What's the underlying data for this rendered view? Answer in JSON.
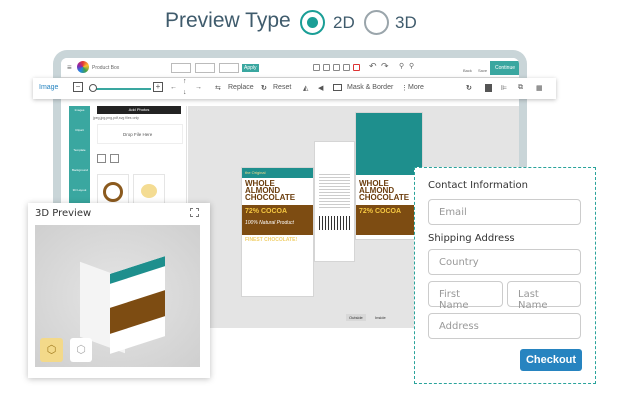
{
  "preview_type": {
    "title": "Preview Type",
    "options": [
      {
        "label": "2D",
        "selected": true
      },
      {
        "label": "3D",
        "selected": false
      }
    ],
    "accent": "#1a9e96"
  },
  "editor": {
    "app_name": "Product Box",
    "apply_label": "Apply",
    "top_right": {
      "back": "Back",
      "save": "Save",
      "continue": "Continue"
    },
    "toolbar": {
      "section": "Image",
      "replace": "Replace",
      "reset": "Reset",
      "mask_border": "Mask & Border",
      "more": "More"
    },
    "sidebar": [
      "Images",
      "Clipart",
      "Template",
      "Background",
      "3D Layout",
      "QR Code"
    ],
    "panel": {
      "add_photos": "Add Photos",
      "hint": "jpeg,jpg,png,pdf,svg files only",
      "drop": "Drop File Here"
    },
    "canvas_tabs": [
      "Outside",
      "Inside"
    ],
    "design": {
      "tagline": "the Original",
      "title_lines": [
        "WHOLE",
        "ALMOND",
        "CHOCOLATE"
      ],
      "cocoa": "72% COCOA",
      "natural": "100% Natural Product",
      "finest": "FINEST CHOCOLATE!"
    },
    "brand_color": "#3aa7a0"
  },
  "preview3d": {
    "title": "3D Preview"
  },
  "checkout_form": {
    "contact_label": "Contact Information",
    "email_placeholder": "Email",
    "shipping_label": "Shipping Address",
    "country_placeholder": "Country",
    "first_name_placeholder": "First Name",
    "last_name_placeholder": "Last Name",
    "address_placeholder": "Address",
    "checkout_label": "Checkout",
    "button_color": "#2784c0"
  }
}
